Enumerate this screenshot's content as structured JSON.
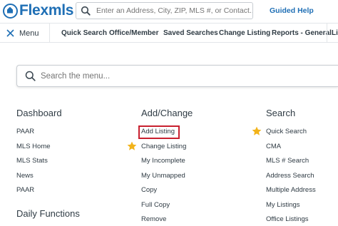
{
  "header": {
    "logo_text": "Flexmls",
    "search_placeholder": "Enter an Address, City, ZIP, MLS #, or Contact...",
    "guided_help": "Guided Help"
  },
  "navbar": {
    "menu_label": "Menu",
    "items": [
      "Quick Search",
      "Office/Member",
      "Saved Searches",
      "Change Listing",
      "Reports - General",
      "Li"
    ]
  },
  "menu_search": {
    "placeholder": "Search the menu..."
  },
  "columns": {
    "dashboard": {
      "title": "Dashboard",
      "items": [
        "PAAR",
        "MLS Home",
        "MLS Stats",
        "News",
        "PAAR"
      ]
    },
    "daily": {
      "title": "Daily Functions"
    },
    "add_change": {
      "title": "Add/Change",
      "items": [
        "Add Listing",
        "Change Listing",
        "My Incomplete",
        "My Unmapped",
        "Copy",
        "Full Copy",
        "Remove"
      ],
      "starred": [
        "Change Listing"
      ],
      "highlighted": "Add Listing"
    },
    "search": {
      "title": "Search",
      "items": [
        "Quick Search",
        "CMA",
        "MLS # Search",
        "Address Search",
        "Multiple Address",
        "My Listings",
        "Office Listings"
      ],
      "starred": [
        "Quick Search"
      ]
    }
  },
  "colors": {
    "brand": "#1f6fb5",
    "text": "#2f3b44",
    "star": "#f2b31a",
    "highlight_border": "#c8202f"
  }
}
